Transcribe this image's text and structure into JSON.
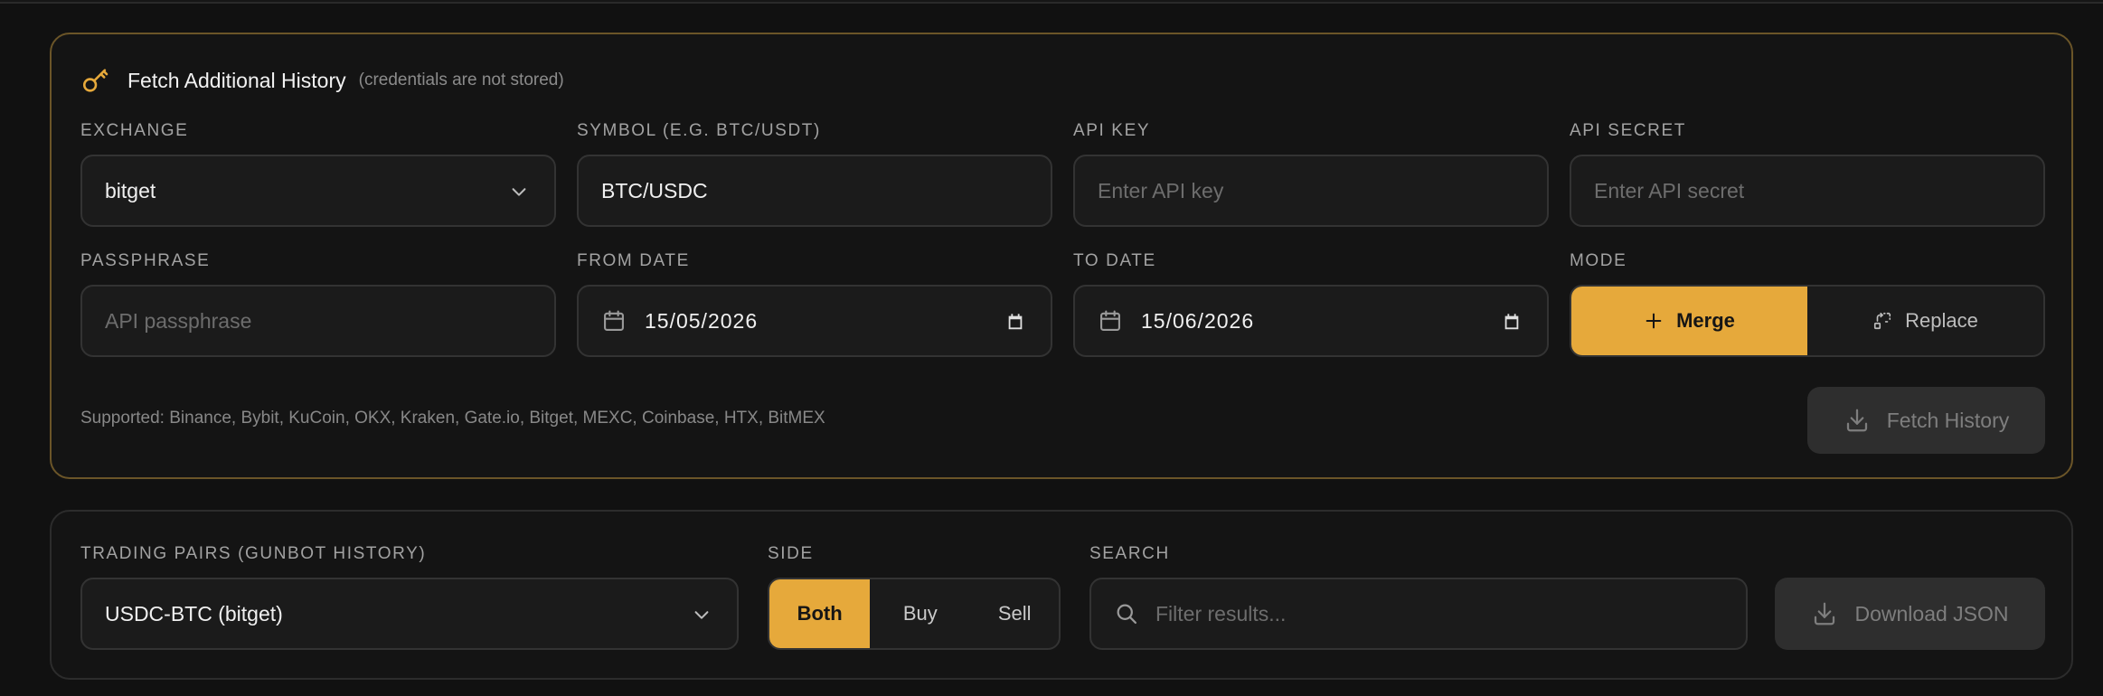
{
  "fetch": {
    "title": "Fetch Additional History",
    "note": "(credentials are not stored)",
    "exchange": {
      "label": "EXCHANGE",
      "value": "bitget"
    },
    "symbol": {
      "label": "SYMBOL (E.G. BTC/USDT)",
      "value": "BTC/USDC"
    },
    "api_key": {
      "label": "API KEY",
      "placeholder": "Enter API key"
    },
    "api_secret": {
      "label": "API SECRET",
      "placeholder": "Enter API secret"
    },
    "passphrase": {
      "label": "PASSPHRASE",
      "placeholder": "API passphrase"
    },
    "from_date": {
      "label": "FROM DATE",
      "value": "15/05/2026"
    },
    "to_date": {
      "label": "TO DATE",
      "value": "15/06/2026"
    },
    "mode": {
      "label": "MODE",
      "options": [
        "Merge",
        "Replace"
      ],
      "selected": "Merge"
    },
    "supported": "Supported: Binance, Bybit, KuCoin, OKX, Kraken, Gate.io, Bitget, MEXC, Coinbase, HTX, BitMEX",
    "fetch_button": "Fetch History"
  },
  "filters": {
    "pairs": {
      "label": "TRADING PAIRS (GUNBOT HISTORY)",
      "value": "USDC-BTC (bitget)"
    },
    "side": {
      "label": "SIDE",
      "options": [
        "Both",
        "Buy",
        "Sell"
      ],
      "selected": "Both"
    },
    "search": {
      "label": "SEARCH",
      "placeholder": "Filter results..."
    },
    "download_button": "Download JSON"
  },
  "colors": {
    "accent": "#e6a93b",
    "panel_border_active": "#6b5528",
    "background": "#111111"
  },
  "icons": [
    "key-icon",
    "chevron-down-icon",
    "calendar-icon",
    "plus-icon",
    "replace-icon",
    "download-icon",
    "search-icon"
  ]
}
